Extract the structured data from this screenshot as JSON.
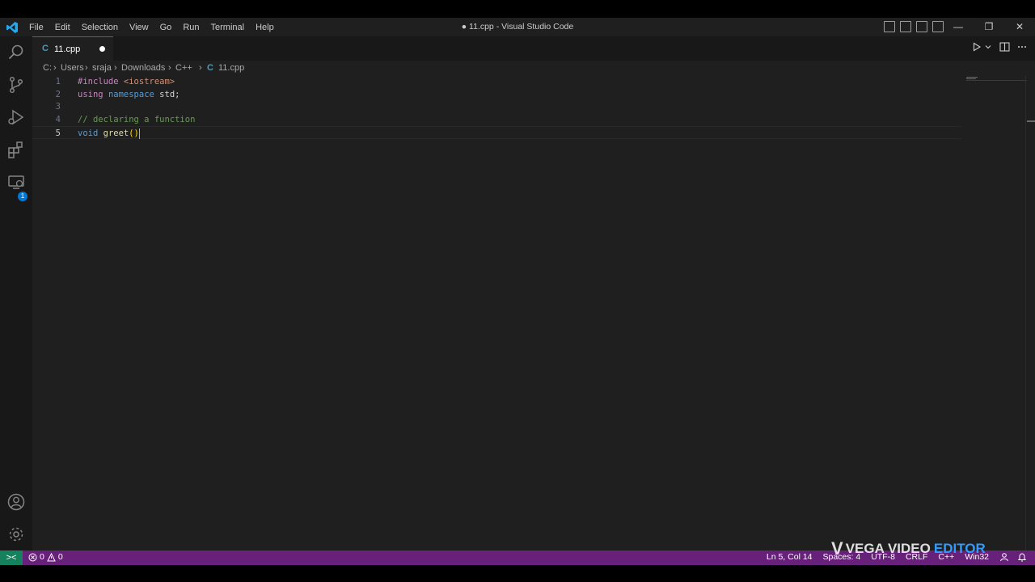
{
  "window": {
    "title": "● 11.cpp - Visual Studio Code",
    "menu": [
      "File",
      "Edit",
      "Selection",
      "View",
      "Go",
      "Run",
      "Terminal",
      "Help"
    ],
    "controls": {
      "minimize": "—",
      "restore": "❐",
      "close": "✕"
    }
  },
  "activity_bar": {
    "icons": [
      "explorer-icon",
      "search-icon",
      "source-control-icon",
      "run-debug-icon",
      "extensions-icon",
      "remote-explorer-icon",
      "accounts-icon",
      "settings-gear-icon"
    ],
    "extensions_badge": "1"
  },
  "tab": {
    "label": "11.cpp",
    "file_icon": "C",
    "dirty": true
  },
  "breadcrumb": [
    "C:",
    "Users",
    "sraja",
    "Downloads",
    "C++",
    "11.cpp"
  ],
  "editor": {
    "line_numbers": [
      "1",
      "2",
      "3",
      "4",
      "5"
    ],
    "lines": [
      {
        "tokens": [
          {
            "t": "#include",
            "c": "kw-purple"
          },
          {
            "t": " ",
            "c": "plain"
          },
          {
            "t": "<iostream>",
            "c": "str"
          }
        ]
      },
      {
        "tokens": [
          {
            "t": "using",
            "c": "kw-purple"
          },
          {
            "t": " ",
            "c": "plain"
          },
          {
            "t": "namespace",
            "c": "kw-blue"
          },
          {
            "t": " ",
            "c": "plain"
          },
          {
            "t": "std",
            "c": "plain"
          },
          {
            "t": ";",
            "c": "plain"
          }
        ]
      },
      {
        "tokens": []
      },
      {
        "tokens": [
          {
            "t": "// declaring a function",
            "c": "comment"
          }
        ]
      },
      {
        "tokens": [
          {
            "t": "void",
            "c": "kw-blue"
          },
          {
            "t": " ",
            "c": "plain"
          },
          {
            "t": "greet",
            "c": "fn"
          },
          {
            "t": "()",
            "c": "paren"
          }
        ]
      }
    ],
    "active_line": 5
  },
  "status_bar": {
    "remote": "><",
    "errors": "0",
    "warnings": "0",
    "position": "Ln 5, Col 14",
    "spaces": "Spaces: 4",
    "encoding": "UTF-8",
    "eol": "CRLF",
    "language": "C++",
    "platform": "Win32"
  },
  "watermark": {
    "mark": "V",
    "word1": "VEGA VIDEO",
    "word2": "EDITOR"
  },
  "colors": {
    "accent": "#0078d4",
    "statusbar": "#68217a",
    "remote": "#16825d",
    "editor_bg": "#1f1f1f"
  }
}
